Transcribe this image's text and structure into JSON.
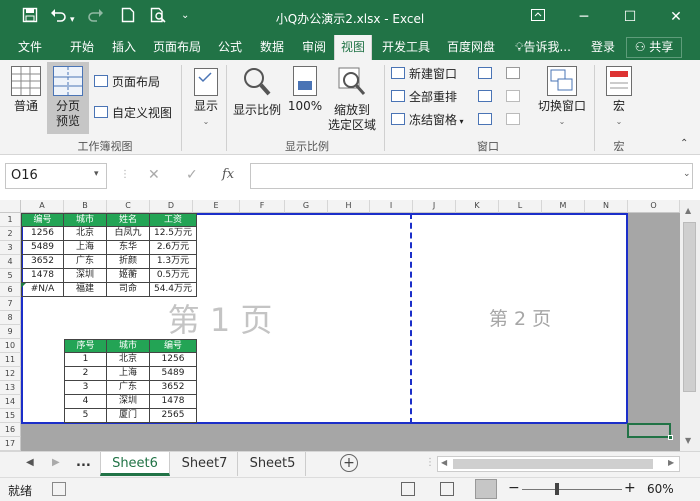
{
  "title": "小Q办公演示2.xlsx - Excel",
  "tabs": [
    "文件",
    "开始",
    "插入",
    "页面布局",
    "公式",
    "数据",
    "审阅",
    "视图",
    "开发工具",
    "百度网盘",
    "告诉我...",
    "登录",
    "共享"
  ],
  "ribbon": {
    "normal": "普通",
    "page_break": "分页\n预览",
    "page_layout": "页面布局",
    "custom_view": "自定义视图",
    "group1": "工作簿视图",
    "show": "显示",
    "zoom": "显示比例",
    "zoom100": "100%",
    "zoom_sel": "缩放到\n选定区域",
    "group3": "显示比例",
    "new_window": "新建窗口",
    "arrange_all": "全部重排",
    "freeze": "冻结窗格",
    "switch_window": "切换窗口",
    "group4": "窗口",
    "macro": "宏",
    "group5": "宏"
  },
  "formula_bar": {
    "name_box": "O16",
    "fx": "fx",
    "value": ""
  },
  "columns": [
    "A",
    "B",
    "C",
    "D",
    "E",
    "F",
    "G",
    "H",
    "I",
    "J",
    "K",
    "L",
    "M",
    "N",
    "O"
  ],
  "rows": [
    "1",
    "2",
    "3",
    "4",
    "5",
    "6",
    "7",
    "8",
    "9",
    "10",
    "11",
    "12",
    "13",
    "14",
    "15",
    "16",
    "17"
  ],
  "table1": {
    "headers": [
      "编号",
      "城市",
      "姓名",
      "工资"
    ],
    "rows": [
      [
        "1256",
        "北京",
        "白凤九",
        "12.5万元"
      ],
      [
        "5489",
        "上海",
        "东华",
        "2.6万元"
      ],
      [
        "3652",
        "广东",
        "折颜",
        "1.3万元"
      ],
      [
        "1478",
        "深圳",
        "姬蘅",
        "0.5万元"
      ],
      [
        "#N/A",
        "福建",
        "司命",
        "54.4万元"
      ]
    ]
  },
  "table2": {
    "headers": [
      "序号",
      "城市",
      "编号"
    ],
    "rows": [
      [
        "1",
        "北京",
        "1256"
      ],
      [
        "2",
        "上海",
        "5489"
      ],
      [
        "3",
        "广东",
        "3652"
      ],
      [
        "4",
        "深圳",
        "1478"
      ],
      [
        "5",
        "厦门",
        "2565"
      ]
    ]
  },
  "page1": "第 1 页",
  "page2": "第 2 页",
  "sheets": [
    "Sheet6",
    "Sheet7",
    "Sheet5"
  ],
  "active_sheet": "Sheet6",
  "sheet_more": "...",
  "status": {
    "ready": "就绪",
    "zoom": "60%"
  }
}
